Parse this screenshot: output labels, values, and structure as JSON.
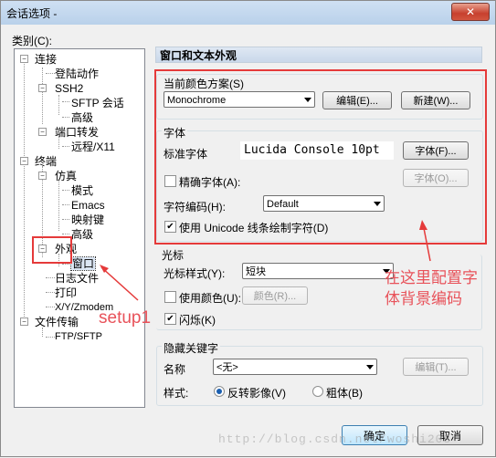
{
  "window": {
    "title": "会话选项 -",
    "close_label": "✕"
  },
  "category_label": "类别(C):",
  "tree": {
    "connect": "连接",
    "login_action": "登陆动作",
    "ssh2": "SSH2",
    "sftp_session": "SFTP 会话",
    "advanced": "高级",
    "port_forward": "端口转发",
    "remote_x11": "远程/X11",
    "terminal": "终端",
    "emulation": "仿真",
    "modes": "模式",
    "emacs": "Emacs",
    "mapping_keys": "映射键",
    "advanced2": "高级",
    "appearance": "外观",
    "window": "窗口",
    "log_file": "日志文件",
    "print": "打印",
    "xyzmodem": "X/Y/Zmodem",
    "file_transfer": "文件传输",
    "ftp_sftp": "FTP/SFTP"
  },
  "panel": {
    "header": "窗口和文本外观",
    "color_scheme_label": "当前颜色方案(S)",
    "color_scheme_value": "Monochrome",
    "edit_button": "编辑(E)...",
    "new_button": "新建(W)...",
    "font_group": "字体",
    "standard_font_label": "标准字体",
    "standard_font_value": "Lucida Console 10pt",
    "font_button": "字体(F)...",
    "precise_font_label": "精确字体(A):",
    "precise_font_button": "字体(O)...",
    "encoding_label": "字符编码(H):",
    "encoding_value": "Default",
    "unicode_line_label": "使用 Unicode 线条绘制字符(D)",
    "cursor_group": "光标",
    "cursor_style_label": "光标样式(Y):",
    "cursor_style_value": "短块",
    "use_color_label": "使用颜色(U):",
    "color_button": "颜色(R)...",
    "blink_label": "闪烁(K)",
    "hidden_group": "隐藏关键字",
    "name_label": "名称",
    "name_value": "<无>",
    "name_edit_button": "编辑(T)...",
    "style_label": "样式:",
    "reverse_label": "反转影像(V)",
    "bold_label": "粗体(B)"
  },
  "buttons": {
    "ok": "确定",
    "cancel": "取消"
  },
  "state": {
    "precise_font_checked": false,
    "unicode_line_checked": true,
    "use_color_checked": false,
    "blink_checked": true,
    "style_selected": "reverse"
  },
  "annotations": {
    "setup1": "setup1",
    "note_line1": "在这里配置字",
    "note_line2": "体背景编码"
  },
  "watermark": "http://blog.csdn.net/woshi208",
  "colors": {
    "annotation_red": "#e53a3a",
    "selection_outline": "#e53a3a"
  }
}
